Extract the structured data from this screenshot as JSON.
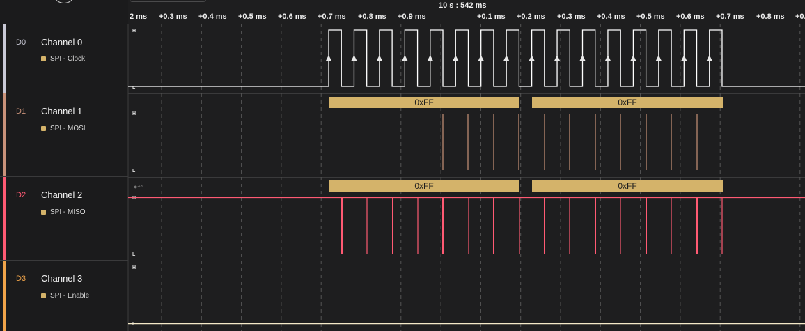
{
  "timeline": {
    "center_label": "10 s : 542 ms",
    "ticks": [
      "2 ms",
      "+0.3 ms",
      "+0.4 ms",
      "+0.5 ms",
      "+0.6 ms",
      "+0.7 ms",
      "+0.8 ms",
      "+0.9 ms",
      "+0.1 ms",
      "+0.2 ms",
      "+0.3 ms",
      "+0.4 ms",
      "+0.5 ms",
      "+0.6 ms",
      "+0.7 ms",
      "+0.8 ms",
      "+0.9 ms"
    ]
  },
  "levels": {
    "high": "H",
    "low": "L"
  },
  "channels": [
    {
      "id": "D0",
      "name": "Channel 0",
      "analyzer": "SPI - Clock",
      "color": "#c9c9d6"
    },
    {
      "id": "D1",
      "name": "Channel 1",
      "analyzer": "SPI - MOSI",
      "color": "#c9927a"
    },
    {
      "id": "D2",
      "name": "Channel 2",
      "analyzer": "SPI - MISO",
      "color": "#ff5a73"
    },
    {
      "id": "D3",
      "name": "Channel 3",
      "analyzer": "SPI - Enable",
      "color": "#f0a44a"
    }
  ],
  "decoded": {
    "mosi": [
      "0xFF",
      "0xFF"
    ],
    "miso": [
      "0xFF",
      "0xFF"
    ]
  },
  "colors": {
    "clock_trace": "#ffffff",
    "mosi_trace": "#e9a98a",
    "miso_trace": "#ff5a73",
    "decode_bubble": "#d4b36a",
    "grid": "#555555"
  }
}
